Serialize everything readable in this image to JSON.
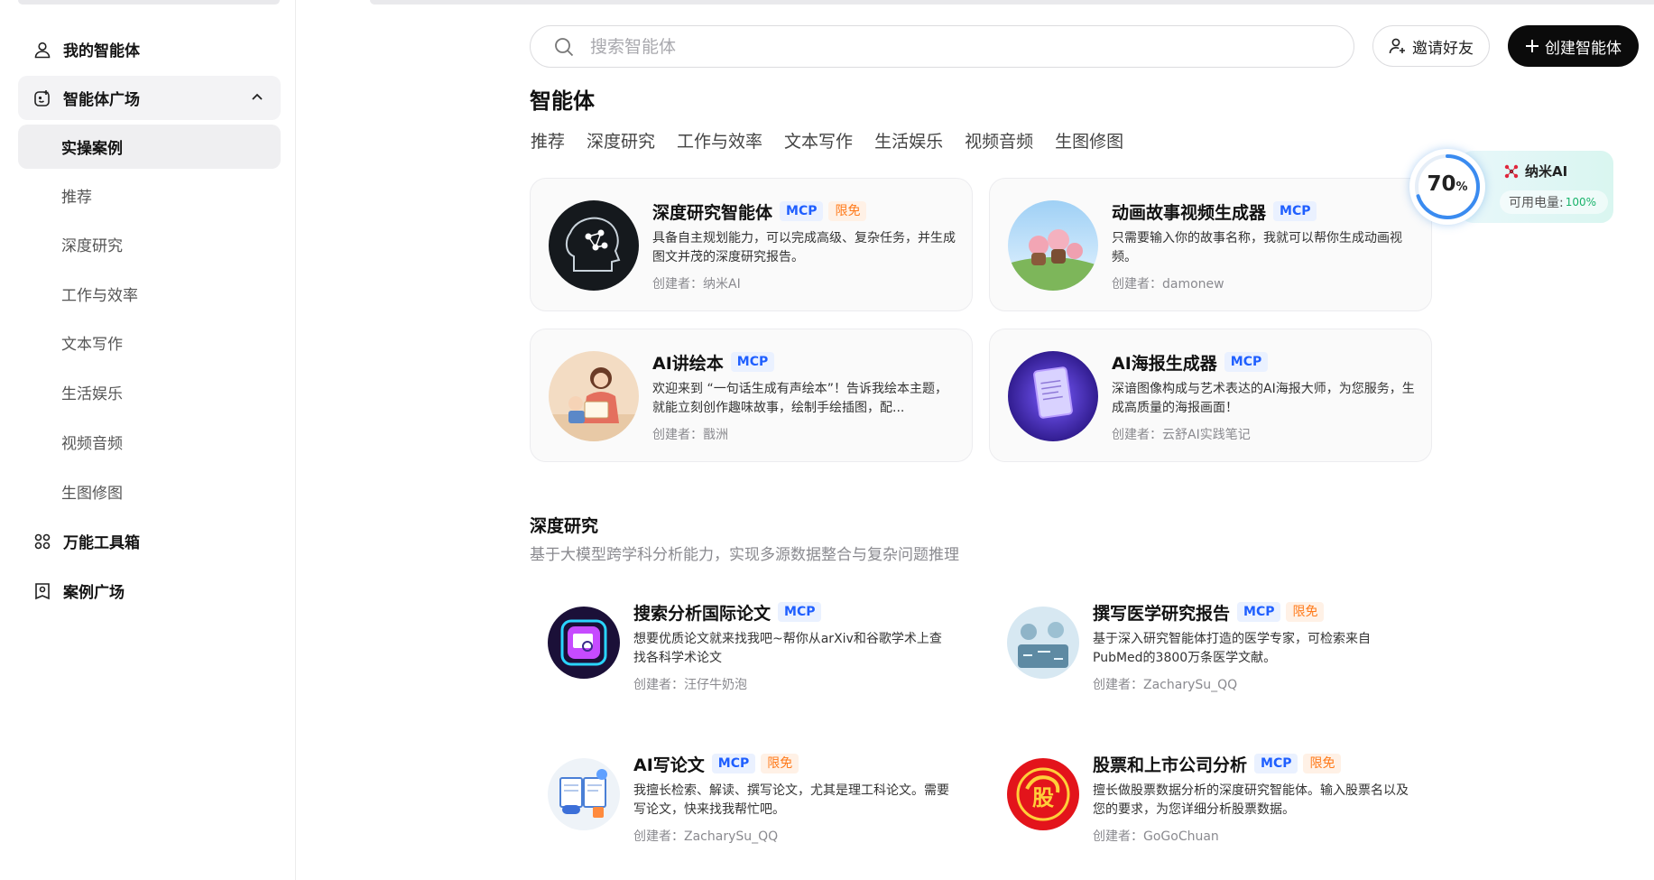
{
  "sidebar": {
    "items": [
      {
        "label": "我的智能体",
        "icon": "user-icon"
      },
      {
        "label": "智能体广场",
        "icon": "plaza-icon"
      },
      {
        "label": "实操案例"
      },
      {
        "label": "推荐"
      },
      {
        "label": "深度研究"
      },
      {
        "label": "工作与效率"
      },
      {
        "label": "文本写作"
      },
      {
        "label": "生活娱乐"
      },
      {
        "label": "视频音频"
      },
      {
        "label": "生图修图"
      },
      {
        "label": "万能工具箱",
        "icon": "grid-icon"
      },
      {
        "label": "案例广场",
        "icon": "case-icon"
      }
    ]
  },
  "search": {
    "placeholder": "搜索智能体"
  },
  "header": {
    "invite_label": "邀请好友",
    "create_label": "创建智能体"
  },
  "main": {
    "title": "智能体",
    "tabs": [
      "推荐",
      "深度研究",
      "工作与效率",
      "文本写作",
      "生活娱乐",
      "视频音频",
      "生图修图"
    ]
  },
  "featured": [
    {
      "title": "深度研究智能体",
      "tags": [
        "MCP",
        "限免"
      ],
      "desc": "具备自主规划能力，可以完成高级、复杂任务，并生成图文并茂的深度研究报告。",
      "author": "创建者：纳米AI"
    },
    {
      "title": "动画故事视频生成器",
      "tags": [
        "MCP"
      ],
      "desc": "只需要输入你的故事名称，我就可以帮你生成动画视频。",
      "author": "创建者：damonew"
    },
    {
      "title": "AI讲绘本",
      "tags": [
        "MCP"
      ],
      "desc": "欢迎来到 “一句话生成有声绘本”！告诉我绘本主题，就能立刻创作趣味故事，绘制手绘插图，配...",
      "author": "创建者：戬洲"
    },
    {
      "title": "AI海报生成器",
      "tags": [
        "MCP"
      ],
      "desc": "深谙图像构成与艺术表达的AI海报大师，为您服务，生成高质量的海报画面！",
      "author": "创建者：云舒AI实践笔记"
    }
  ],
  "section": {
    "title": "深度研究",
    "subtitle": "基于大模型跨学科分析能力，实现多源数据整合与复杂问题推理",
    "cards": [
      {
        "title": "搜索分析国际论文",
        "tags": [
          "MCP"
        ],
        "desc": "想要优质论文就来找我吧~帮你从arXiv和谷歌学术上查找各科学术论文",
        "author": "创建者：汪仔牛奶泡"
      },
      {
        "title": "撰写医学研究报告",
        "tags": [
          "MCP",
          "限免"
        ],
        "desc": "基于深入研究智能体打造的医学专家，可检索来自PubMed的3800万条医学文献。",
        "author": "创建者：ZacharySu_QQ"
      },
      {
        "title": "AI写论文",
        "tags": [
          "MCP",
          "限免"
        ],
        "desc": "我擅长检索、解读、撰写论文，尤其是理工科论文。需要写论文，快来找我帮忙吧。",
        "author": "创建者：ZacharySu_QQ"
      },
      {
        "title": "股票和上市公司分析",
        "tags": [
          "MCP",
          "限免"
        ],
        "desc": "擅长做股票数据分析的深度研究智能体。输入股票名以及您的要求，为您详细分析股票数据。",
        "author": "创建者：GoGoChuan"
      }
    ]
  },
  "widget": {
    "percent": "70",
    "percent_unit": "%",
    "brand": "纳米AI",
    "power_label": "可用电量:",
    "power_value": "100%"
  }
}
